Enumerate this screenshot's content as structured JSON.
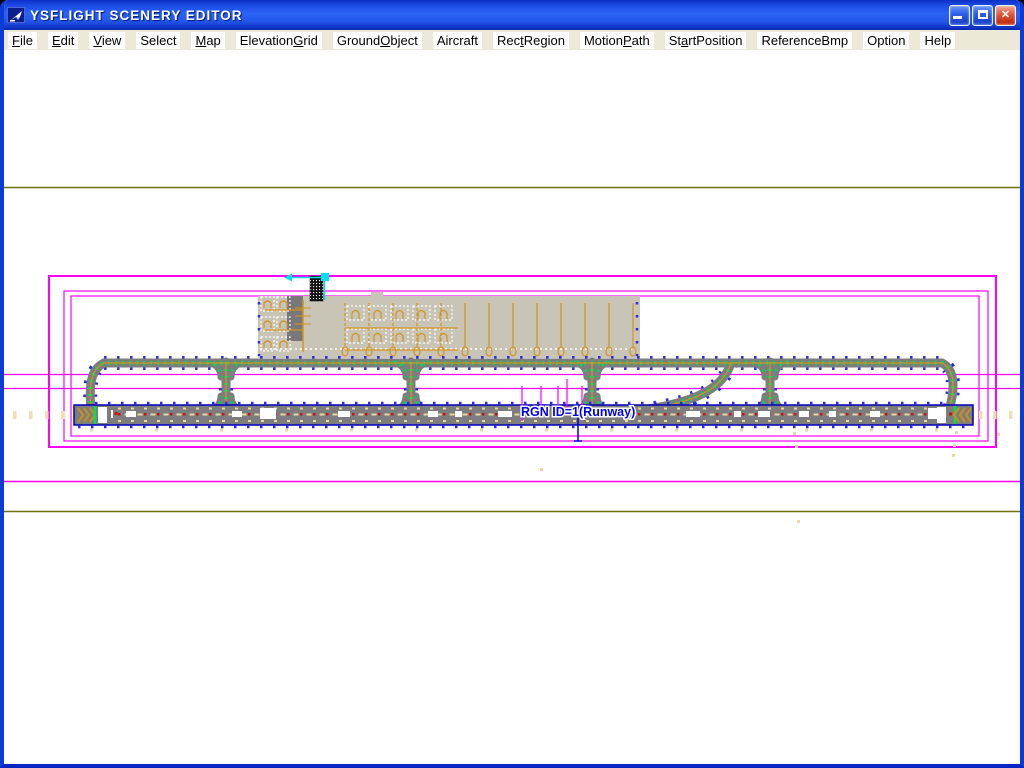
{
  "window": {
    "title": "YSFLIGHT SCENERY EDITOR",
    "icon": "paper-plane-icon",
    "controls": {
      "minimize": "minimize",
      "maximize": "maximize",
      "close": "close"
    }
  },
  "menubar": {
    "items": [
      {
        "label": "File",
        "accel": 0
      },
      {
        "label": "Edit",
        "accel": 0
      },
      {
        "label": "View",
        "accel": 0
      },
      {
        "label": "Select",
        "accel": -1
      },
      {
        "label": "Map",
        "accel": 0
      },
      {
        "label": "ElevationGrid",
        "accel": 9
      },
      {
        "label": "GroundObject",
        "accel": 6
      },
      {
        "label": "Aircraft",
        "accel": -1
      },
      {
        "label": "RectRegion",
        "accel": 3
      },
      {
        "label": "MotionPath",
        "accel": 6
      },
      {
        "label": "StartPosition",
        "accel": 2
      },
      {
        "label": "ReferenceBmp",
        "accel": -1
      },
      {
        "label": "Option",
        "accel": -1
      },
      {
        "label": "Help",
        "accel": -1
      }
    ]
  },
  "canvas": {
    "region_label": "RGN ID=1(Runway)",
    "colors": {
      "grid_olive": "#71710a",
      "region_magenta": "#ff00ff",
      "taxiway_gray": "#7d7d7d",
      "vertex_blue": "#2828e8",
      "path_green": "#00d858",
      "centerline_orange": "#d4941c",
      "edge_tan": "#e8d8a4",
      "runway_outline": "#0000bb",
      "selection_cyan": "#00e0ee",
      "label_blue": "#0000ee"
    }
  }
}
